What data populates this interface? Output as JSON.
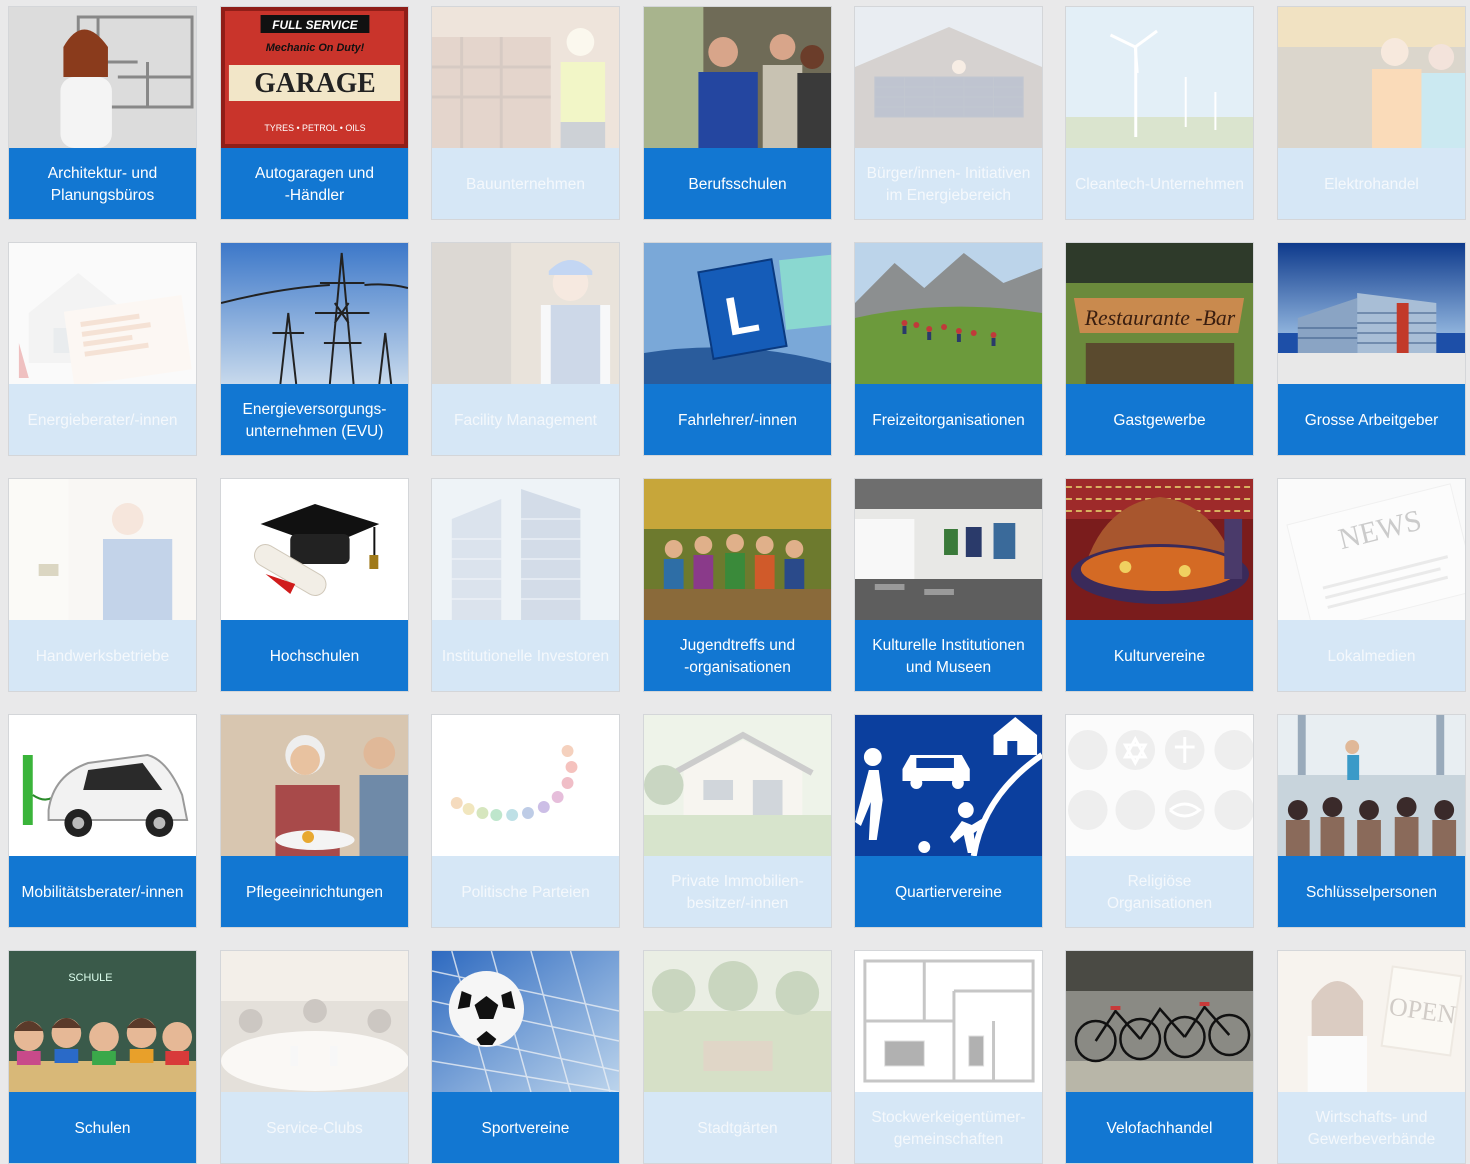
{
  "tiles": [
    {
      "label": "Architektur- und\nPlanungsbüros",
      "active": true,
      "icon": "architect-icon"
    },
    {
      "label": "Autogaragen und\n-Händler",
      "active": true,
      "icon": "garage-sign-icon",
      "image_text": [
        "FULL SERVICE",
        "Mechanic On Duty!",
        "GARAGE",
        "TYRES • PETROL • OILS"
      ]
    },
    {
      "label": "Bauunternehmen",
      "active": false,
      "icon": "construction-icon"
    },
    {
      "label": "Berufsschulen",
      "active": true,
      "icon": "workshop-icon"
    },
    {
      "label": "Bürger/innen- Initiativen\nim Energiebereich",
      "active": false,
      "icon": "solar-roof-icon"
    },
    {
      "label": "Cleantech-Unternehmen",
      "active": false,
      "icon": "wind-turbine-icon"
    },
    {
      "label": "Elektrohandel",
      "active": false,
      "icon": "shop-icon"
    },
    {
      "label": "Energieberater/-innen",
      "active": false,
      "icon": "house-energy-icon"
    },
    {
      "label": "Energieversorgungs-\nunternehmen (EVU)",
      "active": true,
      "icon": "power-pylon-icon"
    },
    {
      "label": "Facility Management",
      "active": false,
      "icon": "technician-icon"
    },
    {
      "label": "Fahrlehrer/-innen",
      "active": true,
      "icon": "learner-plate-icon",
      "image_text": [
        "L"
      ]
    },
    {
      "label": "Freizeitorganisationen",
      "active": true,
      "icon": "mountain-hike-icon"
    },
    {
      "label": "Gastgewerbe",
      "active": true,
      "icon": "restaurant-sign-icon",
      "image_text": [
        "Restaurante -Bar"
      ]
    },
    {
      "label": "Grosse Arbeitgeber",
      "active": true,
      "icon": "office-building-icon"
    },
    {
      "label": "Handwerksbetriebe",
      "active": false,
      "icon": "craftsman-icon"
    },
    {
      "label": "Hochschulen",
      "active": true,
      "icon": "graduation-cap-icon"
    },
    {
      "label": "Institutionelle Investoren",
      "active": false,
      "icon": "skyscraper-icon"
    },
    {
      "label": "Jugendtreffs und\n-organisationen",
      "active": true,
      "icon": "youth-group-icon"
    },
    {
      "label": "Kulturelle Institutionen\nund Museen",
      "active": true,
      "icon": "gallery-icon"
    },
    {
      "label": "Kulturvereine",
      "active": true,
      "icon": "tajine-icon"
    },
    {
      "label": "Lokalmedien",
      "active": false,
      "icon": "newspaper-icon",
      "image_text": [
        "NEWS"
      ]
    },
    {
      "label": "Mobilitätsberater/-innen",
      "active": true,
      "icon": "electric-car-icon"
    },
    {
      "label": "Pflegeeinrichtungen",
      "active": true,
      "icon": "elderly-care-icon"
    },
    {
      "label": "Politische Parteien",
      "active": false,
      "icon": "figures-circle-icon"
    },
    {
      "label": "Private Immobilien-\nbesitzer/-innen",
      "active": false,
      "icon": "villa-icon"
    },
    {
      "label": "Quartiervereine",
      "active": true,
      "icon": "living-street-sign-icon"
    },
    {
      "label": "Religiöse\nOrganisationen",
      "active": false,
      "icon": "religion-symbols-icon"
    },
    {
      "label": "Schlüsselpersonen",
      "active": true,
      "icon": "audience-presentation-icon"
    },
    {
      "label": "Schulen",
      "active": true,
      "icon": "school-children-icon",
      "image_text": [
        "SCHULE"
      ]
    },
    {
      "label": "Service-Clubs",
      "active": false,
      "icon": "club-dinner-icon"
    },
    {
      "label": "Sportvereine",
      "active": true,
      "icon": "soccer-ball-icon"
    },
    {
      "label": "Stadtgärten",
      "active": false,
      "icon": "garden-icon"
    },
    {
      "label": "Stockwerkeigentümer-\ngemeinschaften",
      "active": false,
      "icon": "floor-plan-icon"
    },
    {
      "label": "Velofachhandel",
      "active": true,
      "icon": "bicycles-icon"
    },
    {
      "label": "Wirtschafts- und\nGewerbeverbände",
      "active": false,
      "icon": "open-sign-icon",
      "image_text": [
        "OPEN"
      ]
    }
  ]
}
